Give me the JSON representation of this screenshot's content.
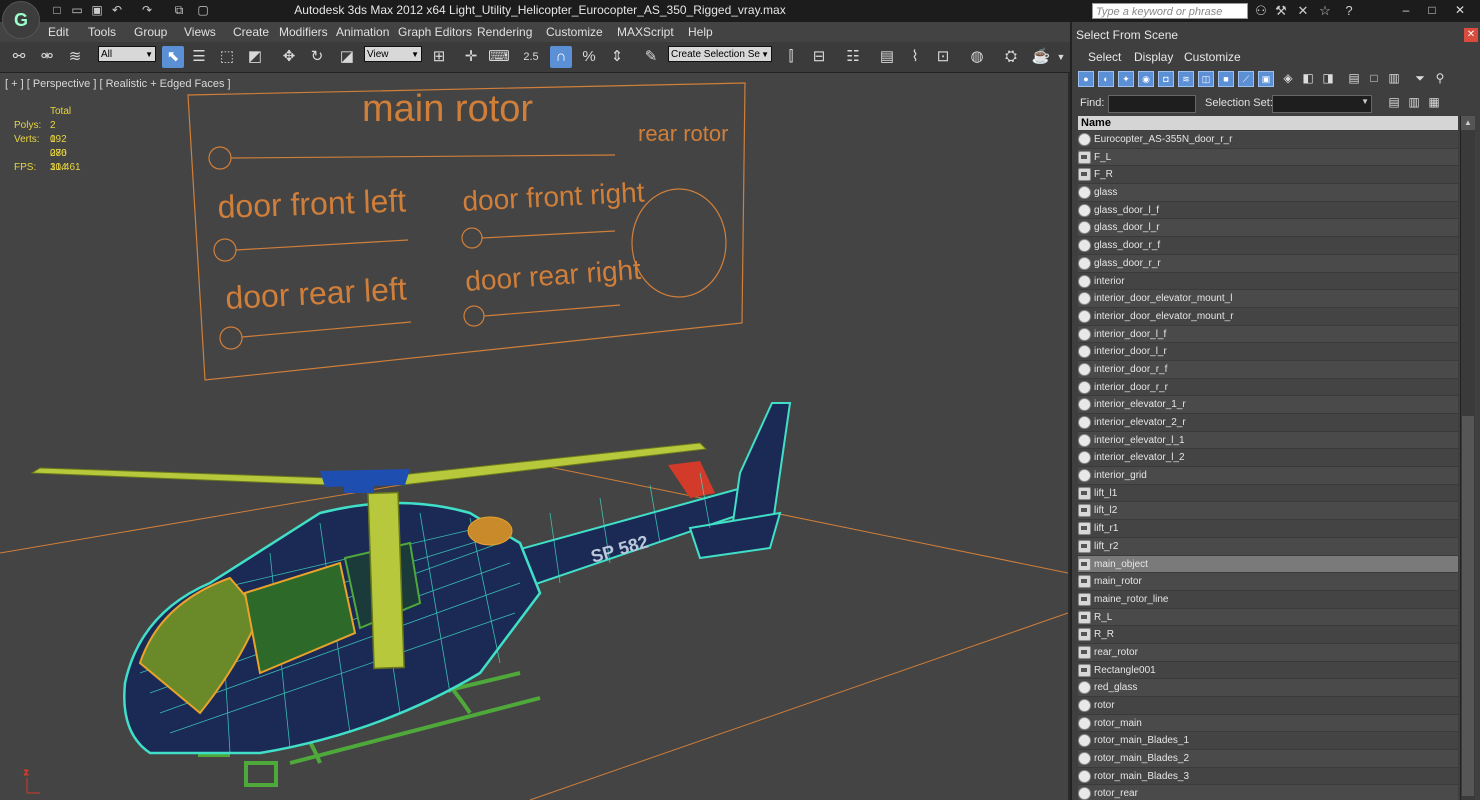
{
  "window": {
    "title": "Autodesk 3ds Max  2012 x64     Light_Utility_Helicopter_Eurocopter_AS_350_Rigged_vray.max",
    "search_placeholder": "Type a keyword or phrase"
  },
  "menu": [
    "Edit",
    "Tools",
    "Group",
    "Views",
    "Create",
    "Modifiers",
    "Animation",
    "Graph Editors",
    "Rendering",
    "Customize",
    "MAXScript",
    "Help"
  ],
  "toolbar": {
    "filter_select": "All",
    "ref_coord": "View",
    "snap_angle": "2.5",
    "selection_set": "Create Selection Se"
  },
  "viewport": {
    "label": "[ + ] [ Perspective ] [ Realistic + Edged Faces ]",
    "stats": {
      "total_label": "Total",
      "polys_label": "Polys:",
      "polys_value": "2 092 280",
      "verts_label": "Verts:",
      "verts_value": "1 076 104",
      "fps_label": "FPS:",
      "fps_value": "31.461"
    },
    "control_panel": {
      "main_rotor": "main rotor",
      "rear_rotor": "rear rotor",
      "door_front_left": "door front left",
      "door_front_right": "door front right",
      "door_rear_left": "door rear left",
      "door_rear_right": "door rear right"
    },
    "tail_text": "SP 582"
  },
  "panel": {
    "title": "Select From Scene",
    "menu": [
      "Select",
      "Display",
      "Customize"
    ],
    "find_label": "Find:",
    "selset_label": "Selection Set:",
    "column_name": "Name",
    "items": [
      {
        "name": "Eurocopter_AS-355N_door_r_r",
        "kind": "geo"
      },
      {
        "name": "F_L",
        "kind": "grp"
      },
      {
        "name": "F_R",
        "kind": "grp"
      },
      {
        "name": "glass",
        "kind": "geo"
      },
      {
        "name": "glass_door_l_f",
        "kind": "geo"
      },
      {
        "name": "glass_door_l_r",
        "kind": "geo"
      },
      {
        "name": "glass_door_r_f",
        "kind": "geo"
      },
      {
        "name": "glass_door_r_r",
        "kind": "geo"
      },
      {
        "name": "interior",
        "kind": "geo"
      },
      {
        "name": "interior_door_elevator_mount_l",
        "kind": "geo"
      },
      {
        "name": "interior_door_elevator_mount_r",
        "kind": "geo"
      },
      {
        "name": "interior_door_l_f",
        "kind": "geo"
      },
      {
        "name": "interior_door_l_r",
        "kind": "geo"
      },
      {
        "name": "interior_door_r_f",
        "kind": "geo"
      },
      {
        "name": "interior_door_r_r",
        "kind": "geo"
      },
      {
        "name": "interior_elevator_1_r",
        "kind": "geo"
      },
      {
        "name": "interior_elevator_2_r",
        "kind": "geo"
      },
      {
        "name": "interior_elevator_l_1",
        "kind": "geo"
      },
      {
        "name": "interior_elevator_l_2",
        "kind": "geo"
      },
      {
        "name": "interior_grid",
        "kind": "geo"
      },
      {
        "name": "lift_l1",
        "kind": "grp"
      },
      {
        "name": "lift_l2",
        "kind": "grp"
      },
      {
        "name": "lift_r1",
        "kind": "grp"
      },
      {
        "name": "lift_r2",
        "kind": "grp"
      },
      {
        "name": "main_object",
        "kind": "grp",
        "selected": true
      },
      {
        "name": "main_rotor",
        "kind": "grp"
      },
      {
        "name": "maine_rotor_line",
        "kind": "grp"
      },
      {
        "name": "R_L",
        "kind": "grp"
      },
      {
        "name": "R_R",
        "kind": "grp"
      },
      {
        "name": "rear_rotor",
        "kind": "grp"
      },
      {
        "name": "Rectangle001",
        "kind": "grp"
      },
      {
        "name": "red_glass",
        "kind": "geo"
      },
      {
        "name": "rotor",
        "kind": "geo"
      },
      {
        "name": "rotor_main",
        "kind": "geo"
      },
      {
        "name": "rotor_main_Blades_1",
        "kind": "geo"
      },
      {
        "name": "rotor_main_Blades_2",
        "kind": "geo"
      },
      {
        "name": "rotor_main_Blades_3",
        "kind": "geo"
      },
      {
        "name": "rotor_rear",
        "kind": "geo"
      }
    ]
  },
  "colors": {
    "stats_text": "#e8d540",
    "rig_lines": "#d07f3a",
    "wire_body": "#40e0c8",
    "gear_green": "#4fa83a",
    "rotor_blade": "#b8c83c",
    "rotor_hub": "#1e4fb0",
    "accent": "#5b8fd6"
  }
}
